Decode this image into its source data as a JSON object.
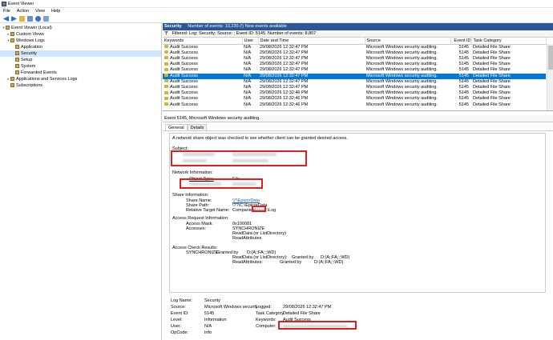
{
  "window": {
    "title": "Event Viewer"
  },
  "menu": [
    "File",
    "Action",
    "View",
    "Help"
  ],
  "toolbar": [
    "back-icon",
    "forward-icon",
    "folder-icon",
    "properties-icon",
    "help-icon",
    "panel-icon"
  ],
  "tree": [
    {
      "label": "Event Viewer (Local)",
      "depth": 0,
      "expanded": true
    },
    {
      "label": "Custom Views",
      "depth": 1,
      "expanded": false
    },
    {
      "label": "Windows Logs",
      "depth": 1,
      "expanded": true
    },
    {
      "label": "Application",
      "depth": 2
    },
    {
      "label": "Security",
      "depth": 2,
      "selected": true
    },
    {
      "label": "Setup",
      "depth": 2
    },
    {
      "label": "System",
      "depth": 2
    },
    {
      "label": "Forwarded Events",
      "depth": 2
    },
    {
      "label": "Applications and Services Logs",
      "depth": 1,
      "expanded": false
    },
    {
      "label": "Subscriptions",
      "depth": 1
    }
  ],
  "log_header": {
    "name": "Security",
    "summary": "Number of events: 10,230 (!) New events available"
  },
  "filter_text": "Filtered: Log: Security; Source: ; Event ID: 5145. Number of events: 8,807",
  "columns": [
    "Keywords",
    "User",
    "Date and Time",
    "Source",
    "Event ID",
    "Task Category"
  ],
  "rows": [
    [
      "Audit Success",
      "N/A",
      "29/08/2026 12:32:47 PM",
      "Microsoft Windows security auditing.",
      "5145",
      "Detailed File Share"
    ],
    [
      "Audit Success",
      "N/A",
      "29/08/2026 12:32:47 PM",
      "Microsoft Windows security auditing.",
      "5145",
      "Detailed File Share"
    ],
    [
      "Audit Success",
      "N/A",
      "29/08/2026 12:32:47 PM",
      "Microsoft Windows security auditing.",
      "5145",
      "Detailed File Share"
    ],
    [
      "Audit Success",
      "N/A",
      "29/08/2026 12:32:47 PM",
      "Microsoft Windows security auditing.",
      "5145",
      "Detailed File Share"
    ],
    [
      "Audit Success",
      "N/A",
      "29/08/2026 12:32:47 PM",
      "Microsoft Windows security auditing.",
      "5145",
      "Detailed File Share"
    ],
    [
      "Audit Success",
      "N/A",
      "29/08/2026 12:32:47 PM",
      "Microsoft Windows security auditing.",
      "5145",
      "Detailed File Share"
    ],
    [
      "Audit Success",
      "N/A",
      "29/08/2026 12:32:47 PM",
      "Microsoft Windows security auditing.",
      "5145",
      "Detailed File Share"
    ],
    [
      "Audit Success",
      "N/A",
      "29/08/2026 12:32:47 PM",
      "Microsoft Windows security auditing.",
      "5145",
      "Detailed File Share"
    ],
    [
      "Audit Success",
      "N/A",
      "29/08/2026 12:32:46 PM",
      "Microsoft Windows security auditing.",
      "5145",
      "Detailed File Share"
    ],
    [
      "Audit Success",
      "N/A",
      "29/08/2026 12:32:46 PM",
      "Microsoft Windows security auditing.",
      "5145",
      "Detailed File Share"
    ],
    [
      "Audit Success",
      "N/A",
      "29/08/2026 12:32:46 PM",
      "Microsoft Windows security auditing.",
      "5145",
      "Detailed File Share"
    ]
  ],
  "selected_row": 5,
  "detail": {
    "title": "Event 5145, Microsoft Windows security auditing.",
    "tabs": [
      "General",
      "Details"
    ],
    "message": {
      "intro": "A network share object was checked to see whether client can be granted desired access.",
      "subject": "Subject:",
      "network_info": "Network Information:",
      "object_type_label": "Object Type:",
      "object_type_value": "File",
      "share_info": "Share Information:",
      "share_name_label": "Share Name:",
      "share_name_value": "\\\\*\\EpicorData",
      "share_path_label": "Share Path:",
      "share_path_value": "\\??\\C:\\EpicorData",
      "rel_target_label": "Relative Target Name:",
      "rel_target_prefix": "Companies\\",
      "rel_target_suffix": "\\Log",
      "access_req": "Access Request Information:",
      "access_mask_label": "Access Mask:",
      "access_mask_value": "0x100081",
      "accesses_label": "Accesses:",
      "accesses_values": [
        "SYNCHRONIZE",
        "ReadData (or ListDirectory)",
        "ReadAttributes"
      ],
      "access_check": "Access Check Results:",
      "check_lines": [
        [
          "SYNCHRONIZE:",
          "Granted by",
          "D:(A;;FA;;;WD)"
        ],
        [
          "ReadData (or ListDirectory):",
          "Granted by",
          "D:(A;;FA;;;WD)"
        ],
        [
          "ReadAttributes:",
          "Granted by",
          "D:(A;;FA;;;WD)"
        ]
      ]
    },
    "props": {
      "log_name_label": "Log Name:",
      "log_name": "Security",
      "source_label": "Source:",
      "source": "Microsoft Windows security",
      "logged_label": "Logged:",
      "logged": "29/08/2026 12:32:47 PM",
      "event_id_label": "Event ID:",
      "event_id": "5145",
      "task_label": "Task Category:",
      "task": "Detailed File Share",
      "level_label": "Level:",
      "level": "Information",
      "keywords_label": "Keywords:",
      "keywords": "Audit Success",
      "user_label": "User:",
      "user": "N/A",
      "computer_label": "Computer:",
      "opcode_label": "OpCode:",
      "opcode": "Info"
    }
  }
}
